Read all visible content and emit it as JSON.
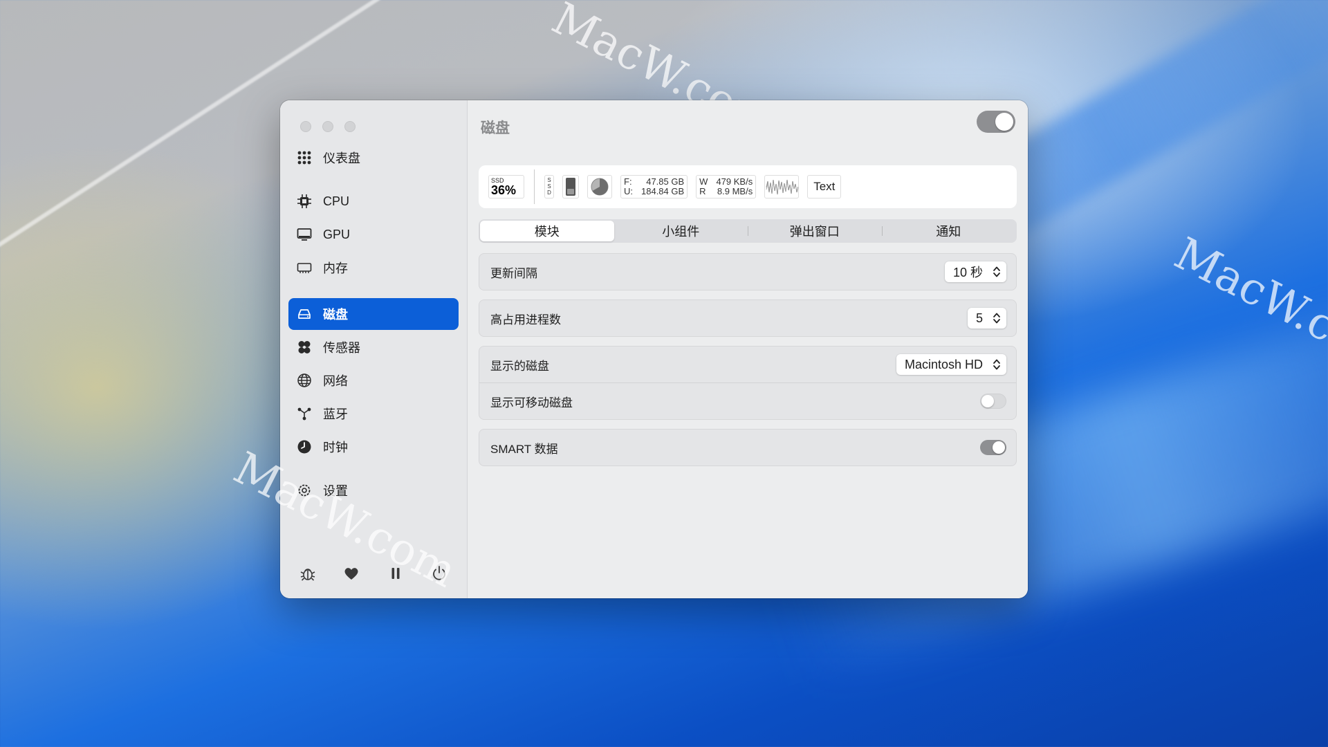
{
  "watermark": {
    "text": "MacW.com"
  },
  "sidebar": {
    "items": [
      {
        "label": "仪表盘",
        "icon": "grid-icon"
      },
      {
        "label": "CPU",
        "icon": "cpu-icon"
      },
      {
        "label": "GPU",
        "icon": "monitor-icon"
      },
      {
        "label": "内存",
        "icon": "memory-icon"
      },
      {
        "label": "磁盘",
        "icon": "disk-icon",
        "active": true
      },
      {
        "label": "传感器",
        "icon": "fan-icon"
      },
      {
        "label": "网络",
        "icon": "globe-icon"
      },
      {
        "label": "蓝牙",
        "icon": "bluetooth-icon"
      },
      {
        "label": "时钟",
        "icon": "clock-icon"
      },
      {
        "label": "设置",
        "icon": "settings-gear-icon"
      }
    ],
    "bottom": [
      "bug-icon",
      "heart-icon",
      "pause-icon",
      "power-icon"
    ]
  },
  "main": {
    "title": "磁盘",
    "enabled": true,
    "preview": {
      "ssd_label": "SSD",
      "ssd_value": "36%",
      "vertical_label": "SSD",
      "free_label": "F:",
      "free_value": "47.85 GB",
      "used_label": "U:",
      "used_value": "184.84 GB",
      "write_label": "W",
      "write_value": "479 KB/s",
      "read_label": "R",
      "read_value": "8.9 MB/s",
      "text_button": "Text"
    },
    "tabs": [
      "模块",
      "小组件",
      "弹出窗口",
      "通知"
    ],
    "selected_tab": 0,
    "settings": {
      "update_interval": {
        "label": "更新间隔",
        "value": "10 秒"
      },
      "top_processes": {
        "label": "高占用进程数",
        "value": "5"
      },
      "shown_disk": {
        "label": "显示的磁盘",
        "value": "Macintosh HD"
      },
      "show_removable": {
        "label": "显示可移动磁盘",
        "enabled": false
      },
      "smart_data": {
        "label": "SMART 数据",
        "enabled": true
      }
    }
  },
  "colors": {
    "accent": "#0c5fd8"
  }
}
